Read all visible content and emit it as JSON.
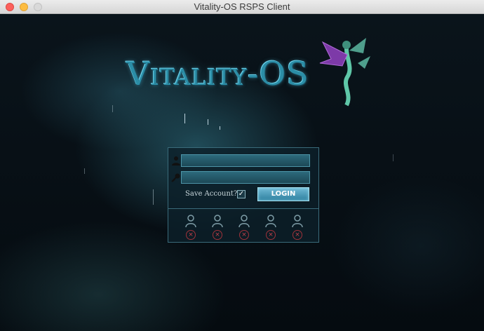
{
  "window": {
    "title": "Vitality-OS RSPS Client"
  },
  "logo": {
    "text": "Vitality-OS"
  },
  "login": {
    "username_value": "",
    "password_value": "",
    "save_account_label": "Save Account?",
    "save_account_checked": true,
    "checkmark": "✓",
    "login_button_label": "LOGIN"
  },
  "saved_accounts": {
    "slots": [
      {
        "delete_glyph": "×"
      },
      {
        "delete_glyph": "×"
      },
      {
        "delete_glyph": "×"
      },
      {
        "delete_glyph": "×"
      },
      {
        "delete_glyph": "×"
      }
    ]
  },
  "colors": {
    "accent": "#2b8da6",
    "panel_border": "#3a6b7a",
    "delete_red": "#c0404a"
  },
  "icons": [
    "user-icon",
    "key-icon",
    "avatar-icon",
    "delete-icon",
    "dragon-logo-icon"
  ]
}
